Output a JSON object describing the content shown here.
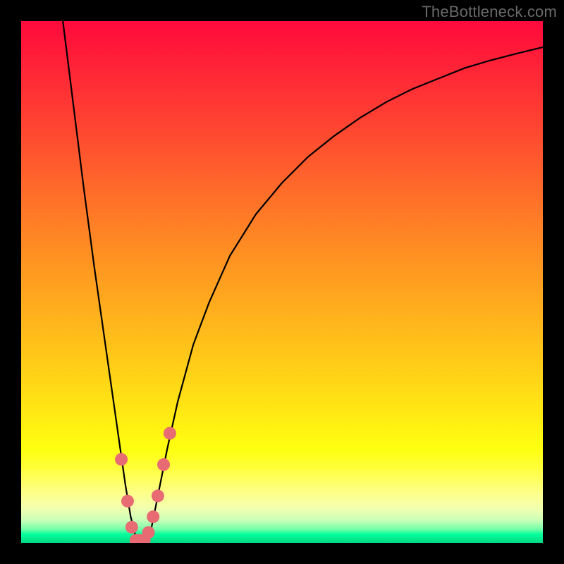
{
  "watermark": "TheBottleneck.com",
  "colors": {
    "curve_stroke": "#000000",
    "marker_fill": "#e86b73",
    "marker_stroke": "#c9535c",
    "frame": "#000000"
  },
  "chart_data": {
    "type": "line",
    "title": "",
    "xlabel": "",
    "ylabel": "",
    "xlim": [
      0,
      100
    ],
    "ylim": [
      0,
      100
    ],
    "legend": false,
    "grid": false,
    "series": [
      {
        "name": "bottleneck-curve",
        "x": [
          8,
          10,
          12,
          14,
          16,
          17,
          18,
          19,
          20,
          21,
          22,
          23,
          24,
          25,
          26,
          28,
          30,
          33,
          36,
          40,
          45,
          50,
          55,
          60,
          65,
          70,
          75,
          80,
          85,
          90,
          95,
          100
        ],
        "y": [
          100,
          84,
          68,
          53,
          39,
          32,
          25,
          18,
          11,
          5,
          1,
          0,
          1,
          3,
          8,
          18,
          27,
          38,
          46,
          55,
          63,
          69,
          74,
          78,
          81.5,
          84.5,
          87,
          89,
          91,
          92.5,
          93.8,
          95
        ]
      }
    ],
    "markers": {
      "name": "highlighted-points",
      "x": [
        19.2,
        20.4,
        21.2,
        22.0,
        22.8,
        23.6,
        24.4,
        25.3,
        26.2,
        27.3,
        28.5
      ],
      "y": [
        16,
        8,
        3,
        0.5,
        0.5,
        0.5,
        2,
        5,
        9,
        15,
        21
      ]
    }
  }
}
